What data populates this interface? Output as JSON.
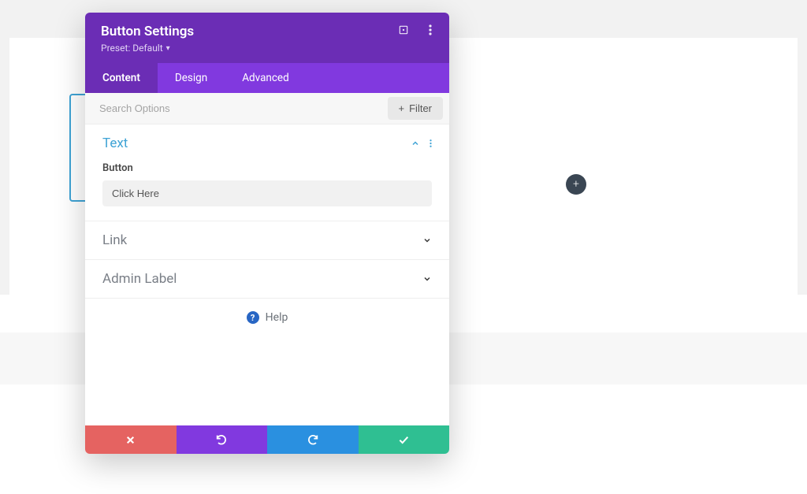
{
  "header": {
    "title": "Button Settings",
    "preset_label": "Preset: Default"
  },
  "tabs": {
    "content": "Content",
    "design": "Design",
    "advanced": "Advanced"
  },
  "search": {
    "placeholder": "Search Options",
    "filter_label": "Filter"
  },
  "sections": {
    "text": {
      "title": "Text",
      "field_label": "Button",
      "field_value": "Click Here"
    },
    "link": {
      "title": "Link"
    },
    "admin_label": {
      "title": "Admin Label"
    }
  },
  "help": {
    "label": "Help"
  },
  "footer_icons": {
    "cancel": "close-icon",
    "undo": "undo-icon",
    "redo": "redo-icon",
    "save": "check-icon"
  },
  "canvas": {
    "add_label": "+"
  }
}
